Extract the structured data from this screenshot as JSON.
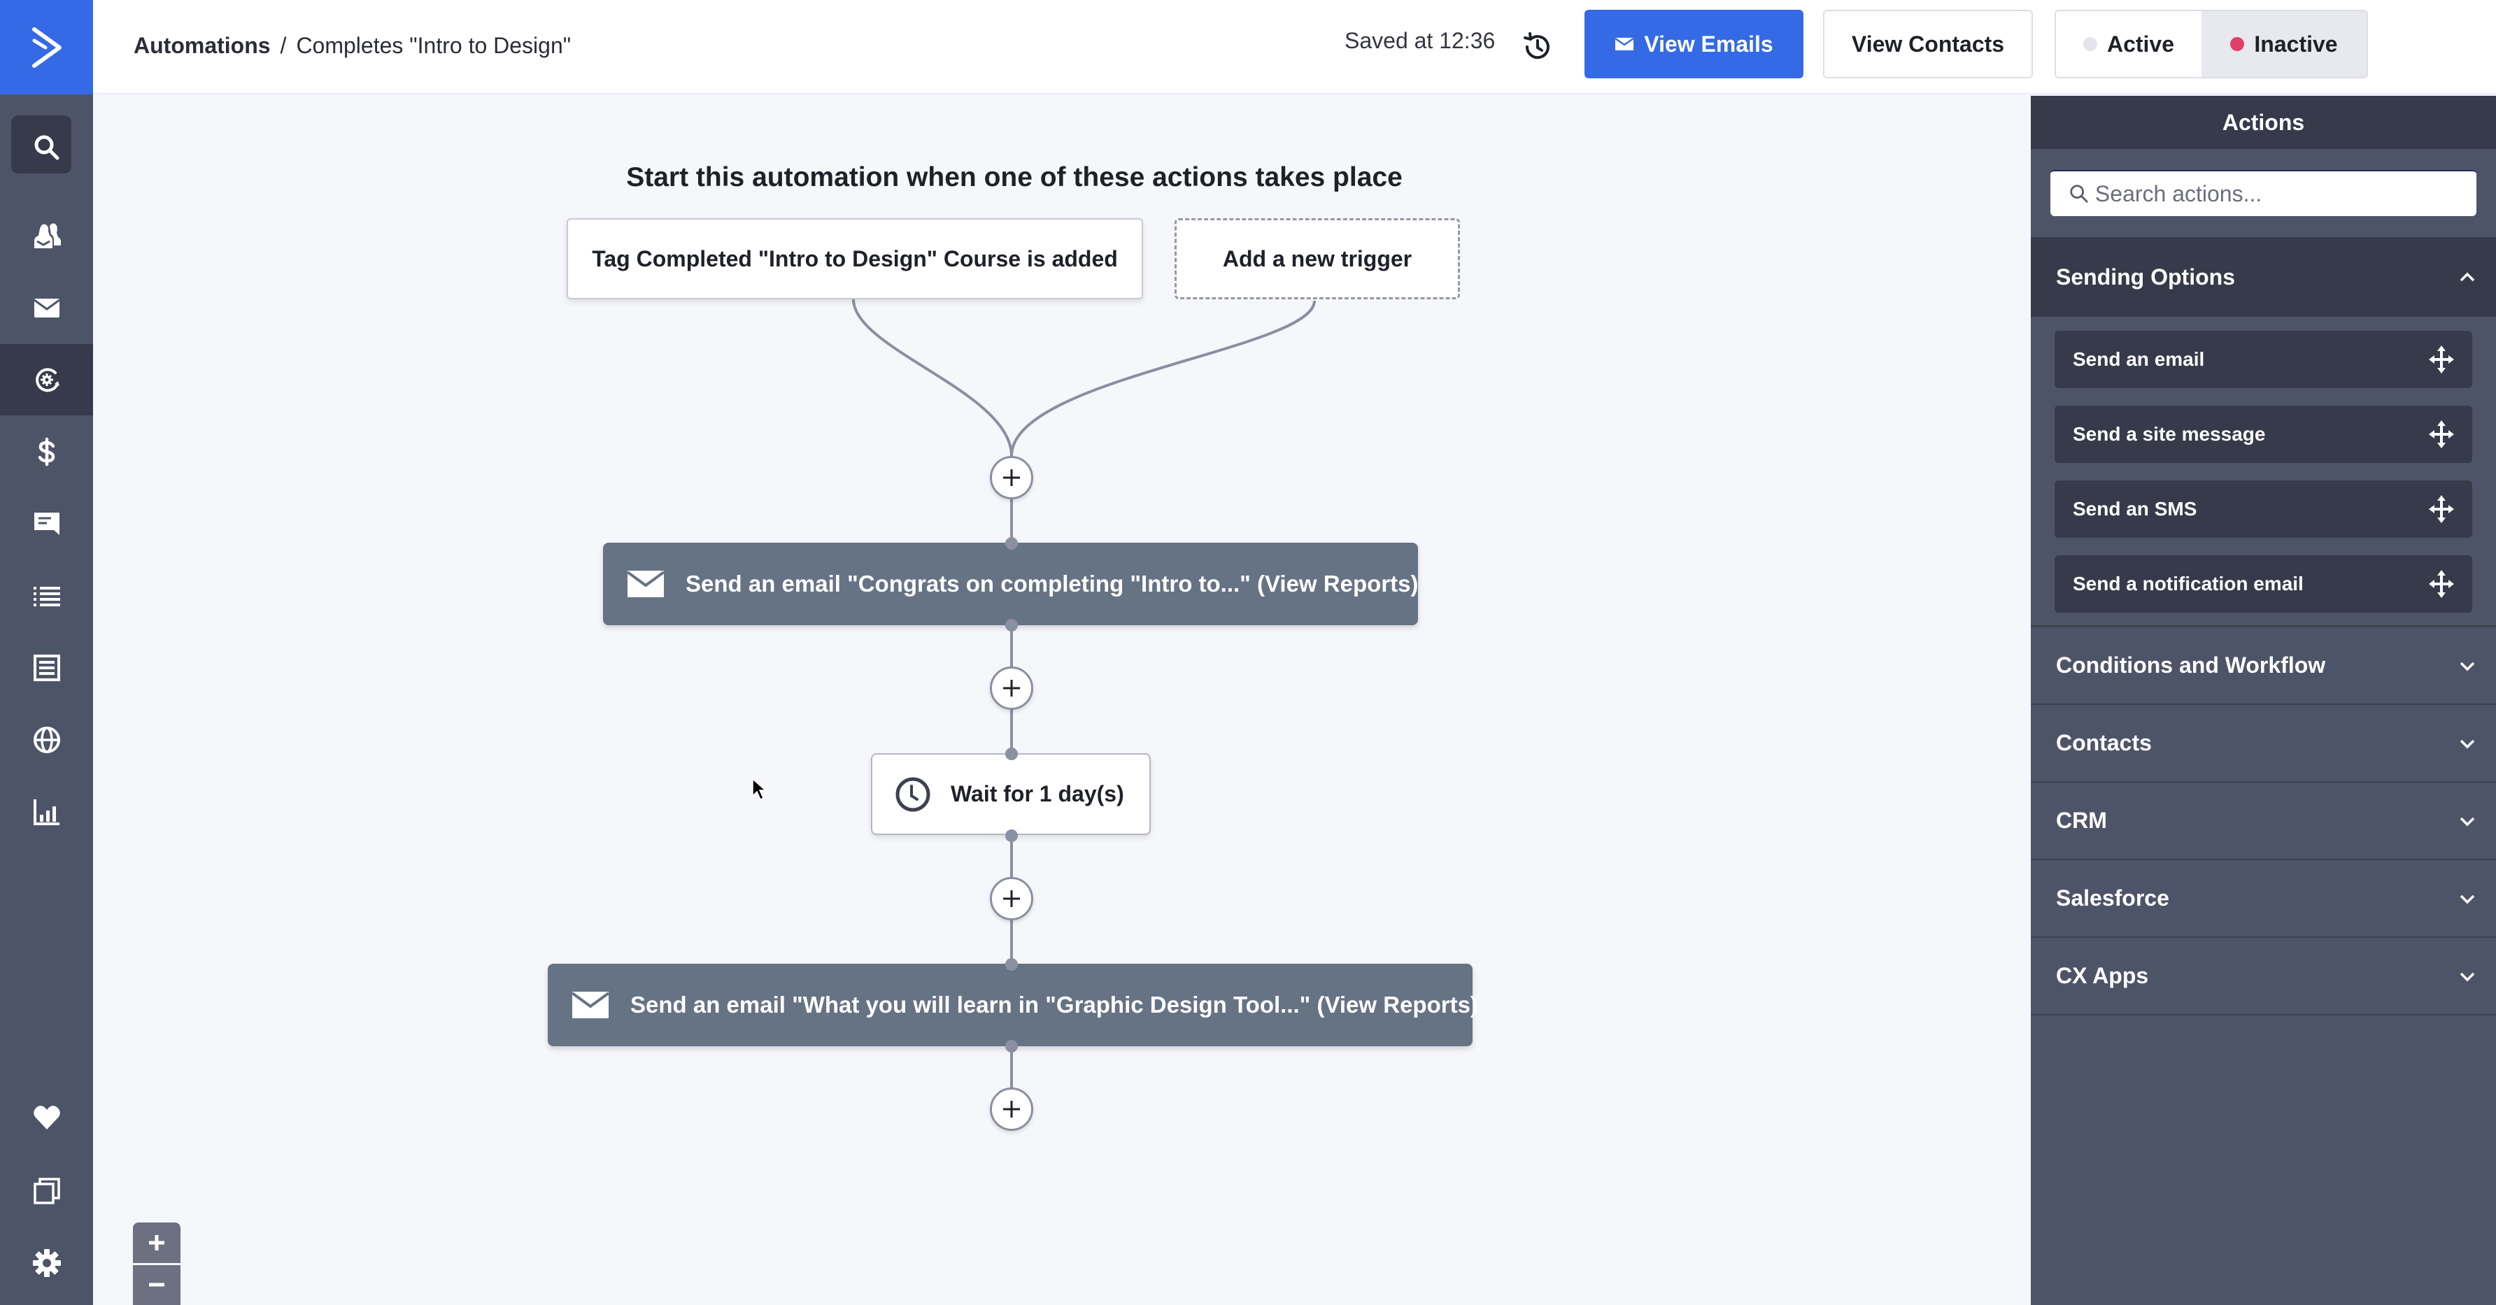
{
  "nav": {
    "logo": "activecampaign-chevron-logo",
    "items": [
      {
        "name": "search",
        "icon": "search-icon",
        "active": false
      },
      {
        "name": "contacts",
        "icon": "contacts-icon",
        "active": false
      },
      {
        "name": "campaigns",
        "icon": "envelope-icon",
        "active": false
      },
      {
        "name": "automations",
        "icon": "automation-icon",
        "active": true
      },
      {
        "name": "deals",
        "icon": "dollar-icon",
        "active": false
      },
      {
        "name": "conversations",
        "icon": "chat-icon",
        "active": false
      },
      {
        "name": "lists",
        "icon": "list-icon",
        "active": false
      },
      {
        "name": "forms",
        "icon": "form-icon",
        "active": false
      },
      {
        "name": "site",
        "icon": "globe-icon",
        "active": false
      },
      {
        "name": "reports",
        "icon": "bar-chart-icon",
        "active": false
      },
      {
        "name": "favorites",
        "icon": "heart-icon",
        "active": false
      },
      {
        "name": "apps",
        "icon": "stacked-squares-icon",
        "active": false
      },
      {
        "name": "settings",
        "icon": "gear-icon",
        "active": false
      }
    ]
  },
  "header": {
    "breadcrumb_root": "Automations",
    "breadcrumb_sep": "/",
    "breadcrumb_current": "Completes \"Intro to Design\"",
    "saved_text": "Saved at 12:36",
    "view_emails_label": "View Emails",
    "view_contacts_label": "View Contacts",
    "status_active_label": "Active",
    "status_inactive_label": "Inactive",
    "status_selected": "Inactive",
    "colors": {
      "brand_blue": "#356ae6",
      "inactive_dot": "#e0406a",
      "active_dot": "#e4e5ec"
    }
  },
  "canvas": {
    "title": "Start this automation when one of these actions takes place",
    "triggers": [
      {
        "label": "Tag Completed \"Intro to Design\" Course is added"
      },
      {
        "label": "Add a new trigger"
      }
    ],
    "steps": [
      {
        "type": "email",
        "label": "Send an email \"Congrats on completing \"Intro to...\" (View Reports)"
      },
      {
        "type": "wait",
        "label": "Wait for 1 day(s)"
      },
      {
        "type": "email",
        "label": "Send an email \"What you will learn in \"Graphic Design Tool...\" (View Reports)"
      }
    ],
    "zoom_in_label": "+",
    "zoom_out_label": "−"
  },
  "panel": {
    "title": "Actions",
    "search_placeholder": "Search actions...",
    "search_value": "",
    "sections": [
      {
        "label": "Sending Options",
        "expanded": true,
        "items": [
          {
            "label": "Send an email"
          },
          {
            "label": "Send a site message"
          },
          {
            "label": "Send an SMS"
          },
          {
            "label": "Send a notification email"
          }
        ]
      },
      {
        "label": "Conditions and Workflow",
        "expanded": false
      },
      {
        "label": "Contacts",
        "expanded": false
      },
      {
        "label": "CRM",
        "expanded": false
      },
      {
        "label": "Salesforce",
        "expanded": false
      },
      {
        "label": "CX Apps",
        "expanded": false
      }
    ]
  }
}
